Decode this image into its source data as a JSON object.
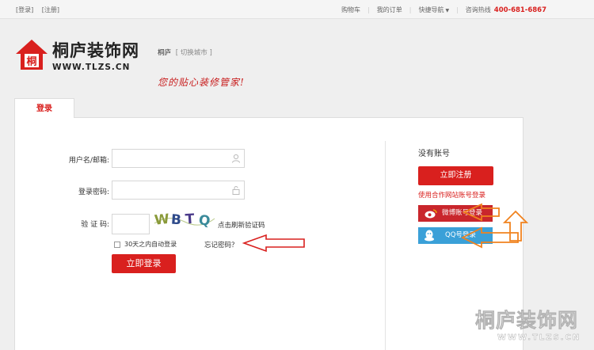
{
  "topbar": {
    "login": "[登录]",
    "register": "[注册]",
    "cart": "购物车",
    "orders": "我的订单",
    "quicknav": "快捷导航",
    "hotline_label": "咨询热线",
    "hotline_number": "400-681-6867"
  },
  "header": {
    "logo_name": "桐庐装饰网",
    "logo_url": "WWW.TLZS.CN",
    "city": "桐庐",
    "switch_city": "[ 切换城市 ]",
    "slogan": "您的贴心装修管家!"
  },
  "login": {
    "tab_label": "登录",
    "username_label": "用户名/邮箱:",
    "password_label": "登录密码:",
    "captcha_label": "验 证 码:",
    "captcha_text": "WBTQ",
    "refresh_label": "点击刷新验证码",
    "remember_label": "30天之内自动登录",
    "forgot_label": "忘记密码？",
    "submit_label": "立即登录"
  },
  "side": {
    "no_account": "没有账号",
    "register_button": "立即注册",
    "partner_title": "使用合作网站账号登录",
    "weibo_button": "微博账号登录",
    "qq_button": "QQ号登录"
  },
  "watermark": {
    "name": "桐庐装饰网",
    "url": "WWW.TLZS.CN"
  },
  "colors": {
    "brand_red": "#d9201e",
    "weibo_red": "#c9262c",
    "qq_blue": "#3aa0d8",
    "arrow_orange": "#f0821e"
  }
}
